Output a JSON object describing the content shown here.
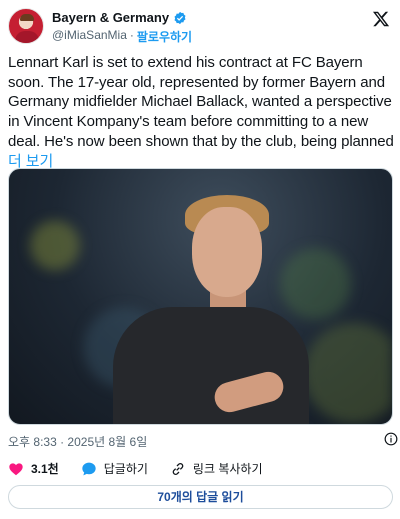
{
  "author": {
    "display_name": "Bayern & Germany",
    "handle": "@iMiaSanMia",
    "separator": "·",
    "follow_label": "팔로우하기"
  },
  "tweet": {
    "text": "Lennart Karl is set to extend his contract at FC Bayern soon. The 17-year old, represented by former Bayern and Germany midfielder Michael Ballack, wanted a perspective in Vincent Kompany's team before committing to a new deal. He's now been shown that by the club, being planned ",
    "more_label": "더 보기"
  },
  "meta": {
    "timestamp": "오후 8:33 · 2025년 8월 6일"
  },
  "actions": {
    "likes": "3.1천",
    "reply_label": "답글하기",
    "copy_link_label": "링크 복사하기"
  },
  "read_replies_label": "70개의 답글 읽기",
  "colors": {
    "accent": "#1d9bf0",
    "like": "#f91880",
    "text": "#0f1419",
    "secondary": "#536471"
  },
  "icons": [
    "verified-badge-icon",
    "x-logo-icon",
    "info-icon",
    "heart-icon",
    "reply-bubble-icon",
    "link-icon"
  ]
}
